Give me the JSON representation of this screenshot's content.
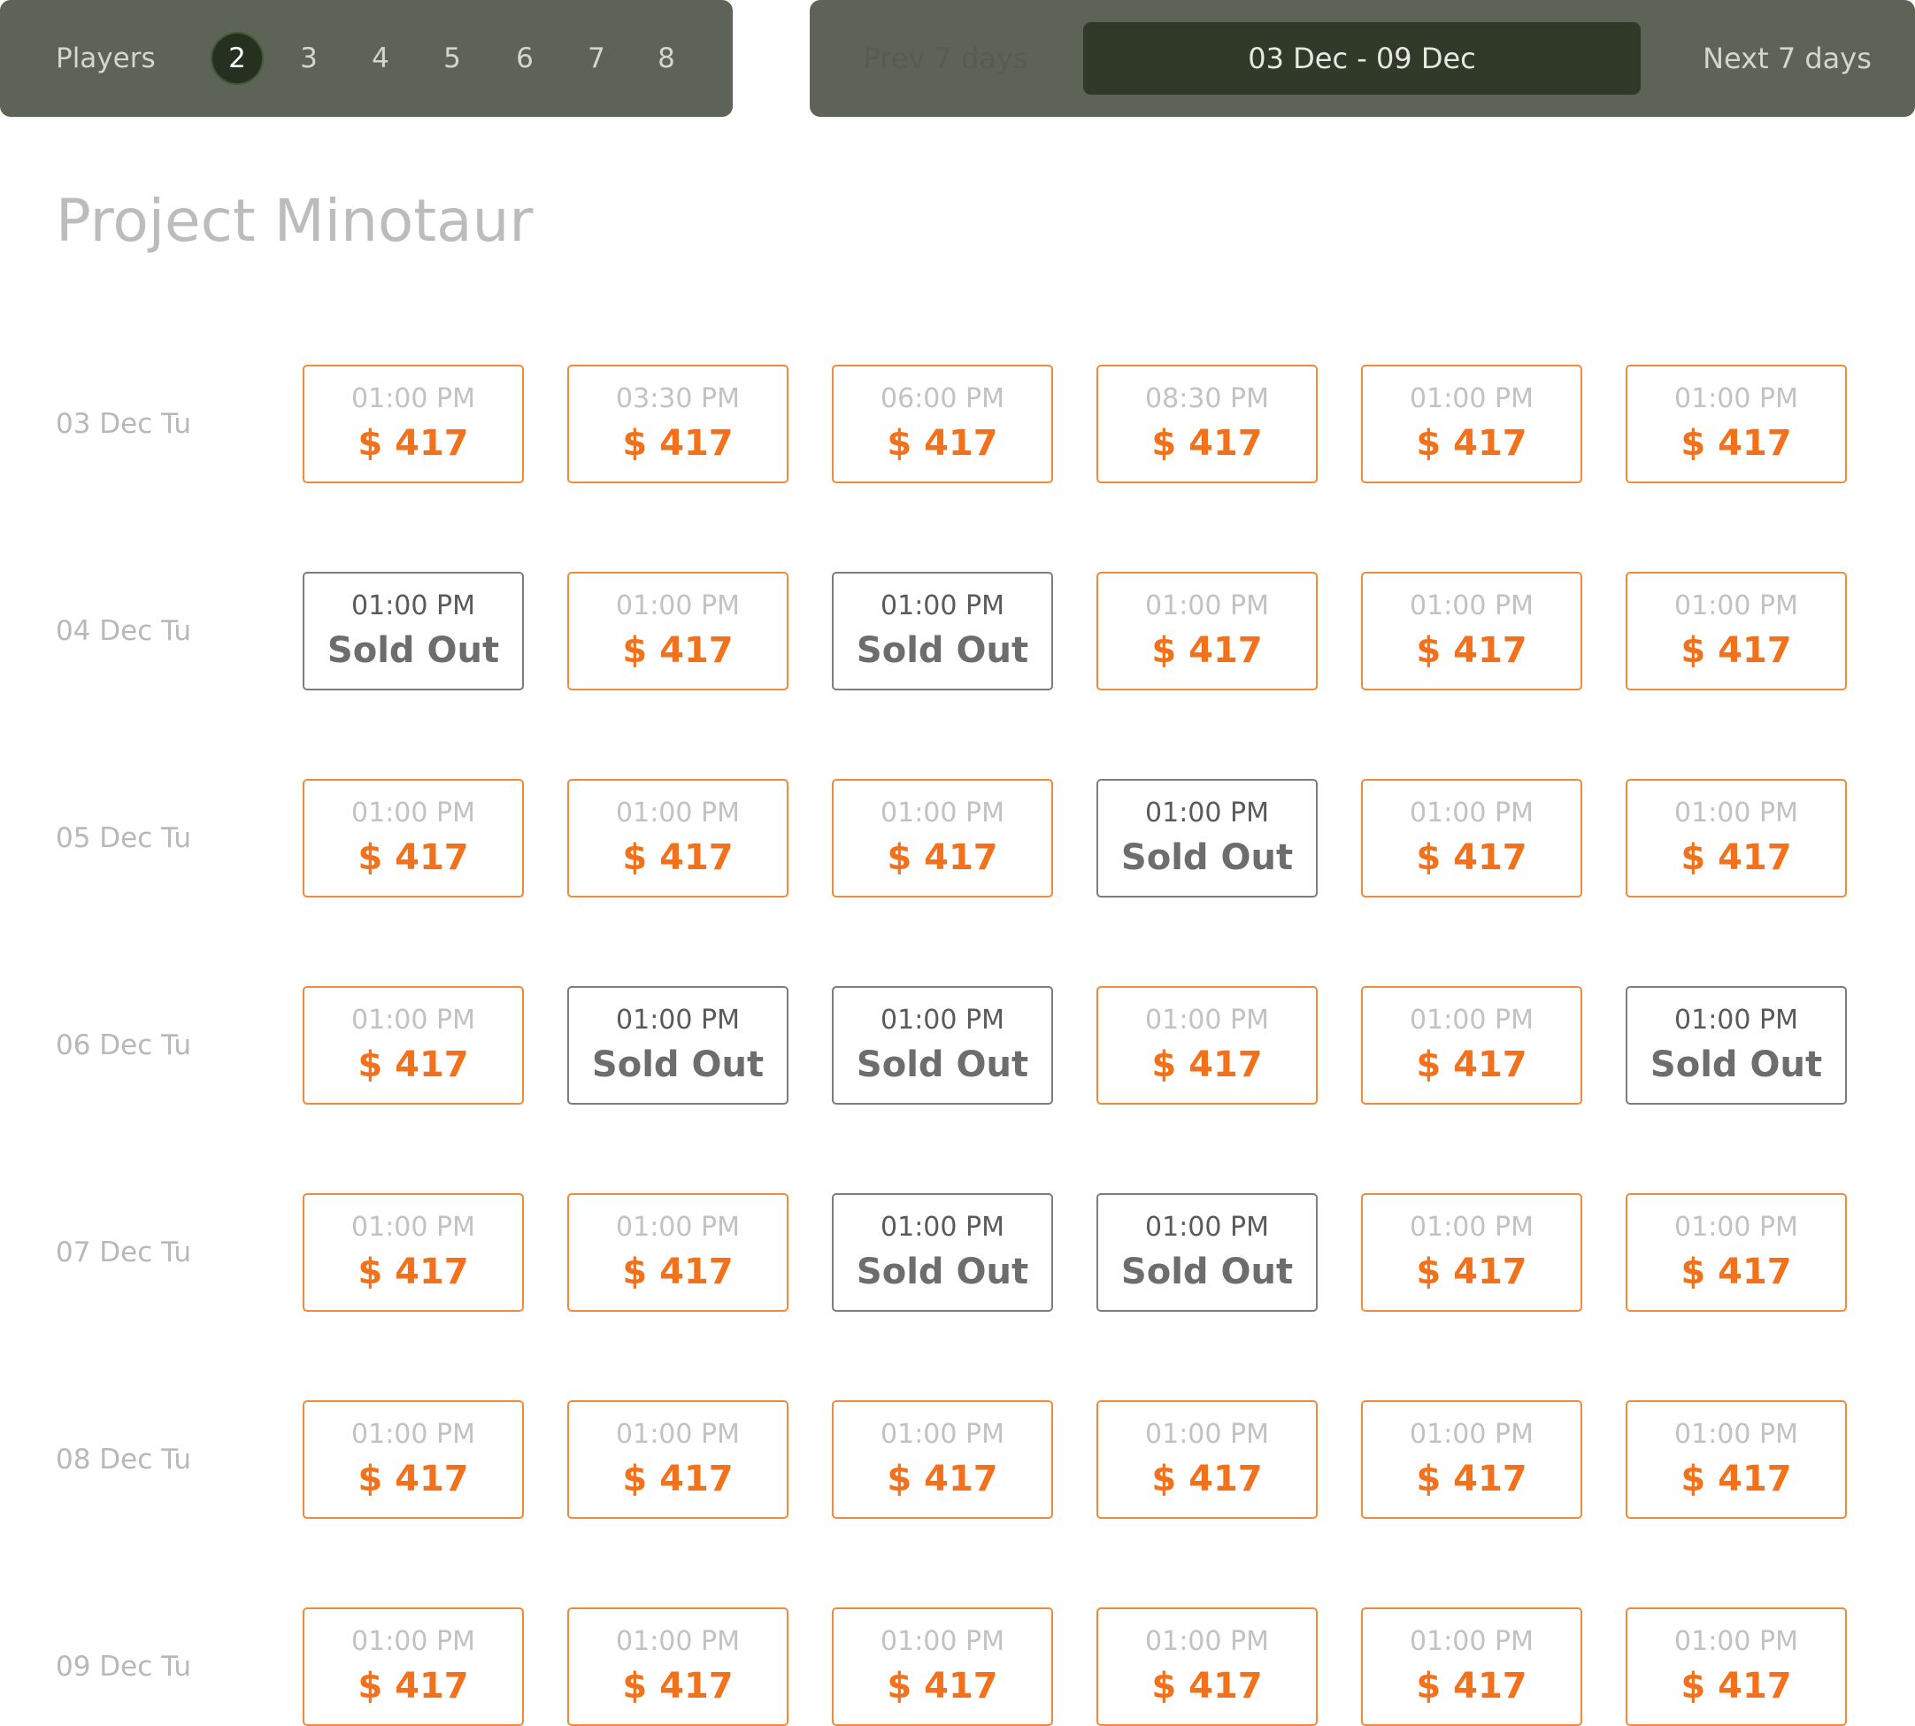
{
  "players": {
    "label": "Players",
    "options": [
      "2",
      "3",
      "4",
      "5",
      "6",
      "7",
      "8"
    ],
    "selected": "2"
  },
  "week_nav": {
    "prev_label": "Prev 7 days",
    "range_label": "03 Dec - 09 Dec",
    "next_label": "Next 7 days"
  },
  "title": "Project Minotaur",
  "colors": {
    "bar_bg": "#5d6357",
    "selected_bg": "#253021",
    "available_accent": "#f3711a",
    "sold_out_border": "#7d7d7d"
  },
  "days": [
    {
      "label": "03 Dec Tu",
      "slots": [
        {
          "time": "01:00 PM",
          "price": "$ 417",
          "status": "available"
        },
        {
          "time": "03:30 PM",
          "price": "$ 417",
          "status": "available"
        },
        {
          "time": "06:00 PM",
          "price": "$ 417",
          "status": "available"
        },
        {
          "time": "08:30 PM",
          "price": "$ 417",
          "status": "available"
        },
        {
          "time": "01:00 PM",
          "price": "$ 417",
          "status": "available"
        },
        {
          "time": "01:00 PM",
          "price": "$ 417",
          "status": "available"
        }
      ]
    },
    {
      "label": "04 Dec Tu",
      "slots": [
        {
          "time": "01:00 PM",
          "price": "Sold Out",
          "status": "sold"
        },
        {
          "time": "01:00 PM",
          "price": "$ 417",
          "status": "available"
        },
        {
          "time": "01:00 PM",
          "price": "Sold Out",
          "status": "sold"
        },
        {
          "time": "01:00 PM",
          "price": "$ 417",
          "status": "available"
        },
        {
          "time": "01:00 PM",
          "price": "$ 417",
          "status": "available"
        },
        {
          "time": "01:00 PM",
          "price": "$ 417",
          "status": "available"
        }
      ]
    },
    {
      "label": "05 Dec Tu",
      "slots": [
        {
          "time": "01:00 PM",
          "price": "$ 417",
          "status": "available"
        },
        {
          "time": "01:00 PM",
          "price": "$ 417",
          "status": "available"
        },
        {
          "time": "01:00 PM",
          "price": "$ 417",
          "status": "available"
        },
        {
          "time": "01:00 PM",
          "price": "Sold Out",
          "status": "sold"
        },
        {
          "time": "01:00 PM",
          "price": "$ 417",
          "status": "available"
        },
        {
          "time": "01:00 PM",
          "price": "$ 417",
          "status": "available"
        }
      ]
    },
    {
      "label": "06 Dec Tu",
      "slots": [
        {
          "time": "01:00 PM",
          "price": "$ 417",
          "status": "available"
        },
        {
          "time": "01:00 PM",
          "price": "Sold Out",
          "status": "sold"
        },
        {
          "time": "01:00 PM",
          "price": "Sold Out",
          "status": "sold"
        },
        {
          "time": "01:00 PM",
          "price": "$ 417",
          "status": "available"
        },
        {
          "time": "01:00 PM",
          "price": "$ 417",
          "status": "available"
        },
        {
          "time": "01:00 PM",
          "price": "Sold Out",
          "status": "sold"
        }
      ]
    },
    {
      "label": "07 Dec Tu",
      "slots": [
        {
          "time": "01:00 PM",
          "price": "$ 417",
          "status": "available"
        },
        {
          "time": "01:00 PM",
          "price": "$ 417",
          "status": "available"
        },
        {
          "time": "01:00 PM",
          "price": "Sold Out",
          "status": "sold"
        },
        {
          "time": "01:00 PM",
          "price": "Sold Out",
          "status": "sold"
        },
        {
          "time": "01:00 PM",
          "price": "$ 417",
          "status": "available"
        },
        {
          "time": "01:00 PM",
          "price": "$ 417",
          "status": "available"
        }
      ]
    },
    {
      "label": "08 Dec Tu",
      "slots": [
        {
          "time": "01:00 PM",
          "price": "$ 417",
          "status": "available"
        },
        {
          "time": "01:00 PM",
          "price": "$ 417",
          "status": "available"
        },
        {
          "time": "01:00 PM",
          "price": "$ 417",
          "status": "available"
        },
        {
          "time": "01:00 PM",
          "price": "$ 417",
          "status": "available"
        },
        {
          "time": "01:00 PM",
          "price": "$ 417",
          "status": "available"
        },
        {
          "time": "01:00 PM",
          "price": "$ 417",
          "status": "available"
        }
      ]
    },
    {
      "label": "09 Dec Tu",
      "slots": [
        {
          "time": "01:00 PM",
          "price": "$ 417",
          "status": "available"
        },
        {
          "time": "01:00 PM",
          "price": "$ 417",
          "status": "available"
        },
        {
          "time": "01:00 PM",
          "price": "$ 417",
          "status": "available"
        },
        {
          "time": "01:00 PM",
          "price": "$ 417",
          "status": "available"
        },
        {
          "time": "01:00 PM",
          "price": "$ 417",
          "status": "available"
        },
        {
          "time": "01:00 PM",
          "price": "$ 417",
          "status": "available"
        }
      ]
    }
  ]
}
